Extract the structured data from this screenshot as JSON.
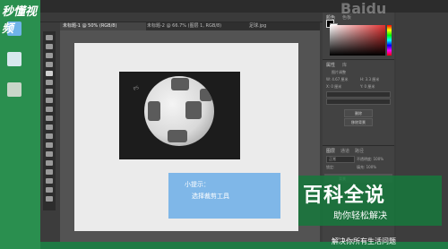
{
  "watermark": {
    "logo": "秒懂视频",
    "brand_cn": "百科全说",
    "brand_sub": "助你轻松解决",
    "slogan": "解决你所有生活问题",
    "baidu": "Baidu"
  },
  "document": {
    "tabs": [
      "未标题-1 @ 50% (RGB/8)",
      "未标题-2 @ 66.7% (图层 1, RGB/8)",
      "足球.jpg"
    ],
    "photo_mark": "PS"
  },
  "tip": {
    "title": "小提示：",
    "body": "选择裁剪工具"
  },
  "panels": {
    "color_tab": "颜色",
    "swatch_tab": "色板",
    "properties_tab": "属性",
    "libraries_tab": "库",
    "properties_title": "图片调整",
    "w_label": "W: 4.67 厘米",
    "h_label": "H: 3.3 厘米",
    "x_label": "X: 0 厘米",
    "y_label": "Y: 0 厘米",
    "layers_tab": "图层",
    "channels_tab": "通道",
    "paths_tab": "路径",
    "normal_mode": "正常",
    "opacity_label": "不透明度: 100%",
    "fill_label": "填充: 100%",
    "lock_label": "锁定:",
    "layer_name": "背景",
    "button_1": "删除",
    "button_2": "移除背景"
  },
  "colors": {
    "desktop_green": "#1e7a44",
    "tip_blue": "#7fb7e8",
    "ps_dark": "#3c3c3c"
  }
}
